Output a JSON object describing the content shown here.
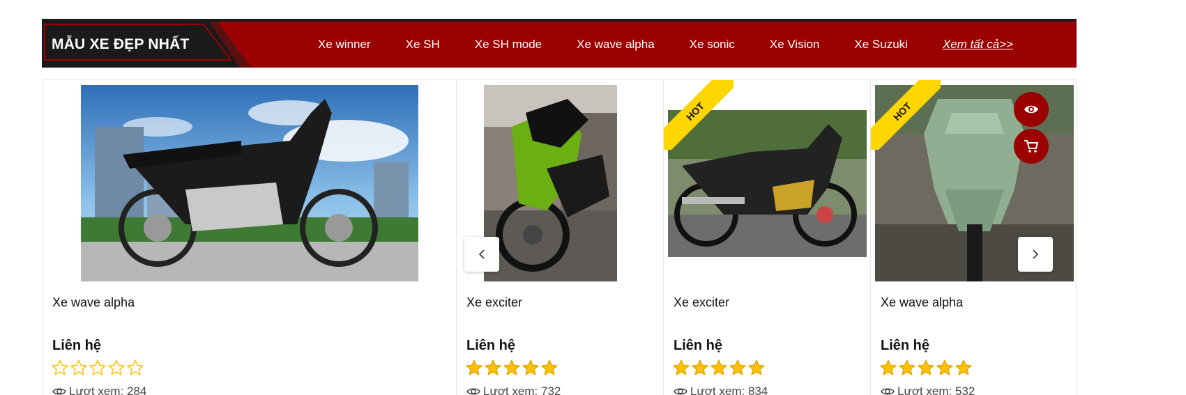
{
  "section": {
    "title": "MẪU XE ĐẸP NHẤT",
    "nav": [
      "Xe winner",
      "Xe SH",
      "Xe SH mode",
      "Xe wave alpha",
      "Xe sonic",
      "Xe Vision",
      "Xe Suzuki"
    ],
    "view_all": "Xem tất cả>>"
  },
  "colors": {
    "primary": "#9b0101",
    "dark": "#1a1a1a",
    "hot_badge": "#ffd600",
    "star": "#ffc107"
  },
  "products": [
    {
      "name": "Xe wave alpha",
      "price": "Liên hệ",
      "rating": 0,
      "views_label": "Lượt xem:",
      "views": "284",
      "hot": false
    },
    {
      "name": "Xe exciter",
      "price": "Liên hệ",
      "rating": 5,
      "views_label": "Lượt xem:",
      "views": "732",
      "hot": false
    },
    {
      "name": "Xe exciter",
      "price": "Liên hệ",
      "rating": 5,
      "views_label": "Lượt xem:",
      "views": "834",
      "hot": true,
      "badge": "HOT"
    },
    {
      "name": "Xe wave alpha",
      "price": "Liên hệ",
      "rating": 5,
      "views_label": "Lượt xem:",
      "views": "532",
      "hot": true,
      "badge": "HOT"
    }
  ],
  "icons": {
    "quick_view": "eye-icon",
    "add_to_cart": "cart-icon",
    "prev": "chevron-left-icon",
    "next": "chevron-right-icon"
  }
}
